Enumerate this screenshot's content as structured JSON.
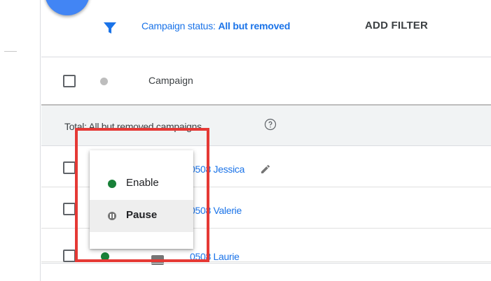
{
  "filter_bar": {
    "filter_prefix": "Campaign status: ",
    "filter_value": "All but removed",
    "add_filter_label": "ADD FILTER"
  },
  "table": {
    "header": {
      "campaign_column": "Campaign"
    },
    "total_label": "Total: All but removed campaigns",
    "rows": [
      {
        "name": "0508 Jessica",
        "status": "enabled"
      },
      {
        "name": "0508 Valerie",
        "status": "enabled"
      },
      {
        "name": "0508 Laurie",
        "status": "enabled"
      }
    ]
  },
  "status_menu": {
    "items": [
      {
        "label": "Enable",
        "icon": "enabled-dot-icon"
      },
      {
        "label": "Pause",
        "icon": "pause-icon"
      }
    ]
  },
  "colors": {
    "accent": "#1a73e8",
    "enabled": "#188038",
    "highlight": "#e53935"
  }
}
